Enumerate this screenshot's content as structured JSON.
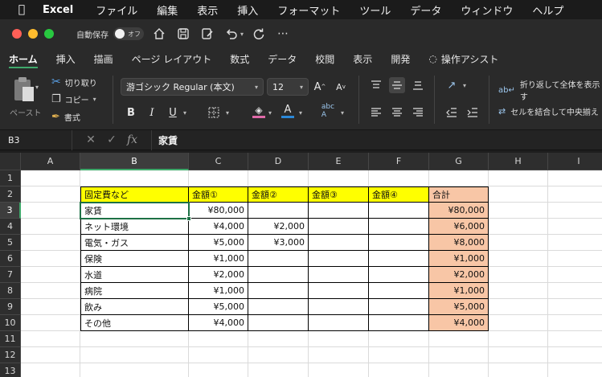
{
  "menubar": {
    "app": "Excel",
    "items": [
      "ファイル",
      "編集",
      "表示",
      "挿入",
      "フォーマット",
      "ツール",
      "データ",
      "ウィンドウ",
      "ヘルプ"
    ]
  },
  "titlebar": {
    "autosave_label": "自動保存",
    "autosave_state": "オフ"
  },
  "ribbon_tabs": {
    "items": [
      "ホーム",
      "挿入",
      "描画",
      "ページ レイアウト",
      "数式",
      "データ",
      "校閲",
      "表示",
      "開発",
      "操作アシスト"
    ],
    "active": "ホーム"
  },
  "ribbon": {
    "paste_label": "ペースト",
    "cut_label": "切り取り",
    "copy_label": "コピー",
    "format_painter_label": "書式",
    "font_name": "游ゴシック Regular (本文)",
    "font_size": "12",
    "wrap_text_label": "折り返して全体を表示す",
    "merge_center_label": "セルを結合して中央揃え"
  },
  "formula_bar": {
    "name_box": "B3",
    "fx": "fx",
    "content": "家賃"
  },
  "sheet": {
    "columns": [
      "A",
      "B",
      "C",
      "D",
      "E",
      "F",
      "G",
      "H",
      "I"
    ],
    "rows": [
      "1",
      "2",
      "3",
      "4",
      "5",
      "6",
      "7",
      "8",
      "9",
      "10",
      "11",
      "12",
      "13"
    ],
    "selected_cell": "B3",
    "header_row": [
      "固定費など",
      "金額①",
      "金額②",
      "金額③",
      "金額④",
      "合計"
    ],
    "data_rows": [
      [
        "家賃",
        "¥80,000",
        "",
        "",
        "",
        "¥80,000"
      ],
      [
        "ネット環境",
        "¥4,000",
        "¥2,000",
        "",
        "",
        "¥6,000"
      ],
      [
        "電気・ガス",
        "¥5,000",
        "¥3,000",
        "",
        "",
        "¥8,000"
      ],
      [
        "保険",
        "¥1,000",
        "",
        "",
        "",
        "¥1,000"
      ],
      [
        "水道",
        "¥2,000",
        "",
        "",
        "",
        "¥2,000"
      ],
      [
        "病院",
        "¥1,000",
        "",
        "",
        "",
        "¥1,000"
      ],
      [
        "飲み",
        "¥5,000",
        "",
        "",
        "",
        "¥5,000"
      ],
      [
        "その他",
        "¥4,000",
        "",
        "",
        "",
        "¥4,000"
      ]
    ],
    "colors": {
      "header_fill": "#ffff00",
      "total_fill": "#f8c6a6",
      "accent": "#1e7145"
    }
  }
}
